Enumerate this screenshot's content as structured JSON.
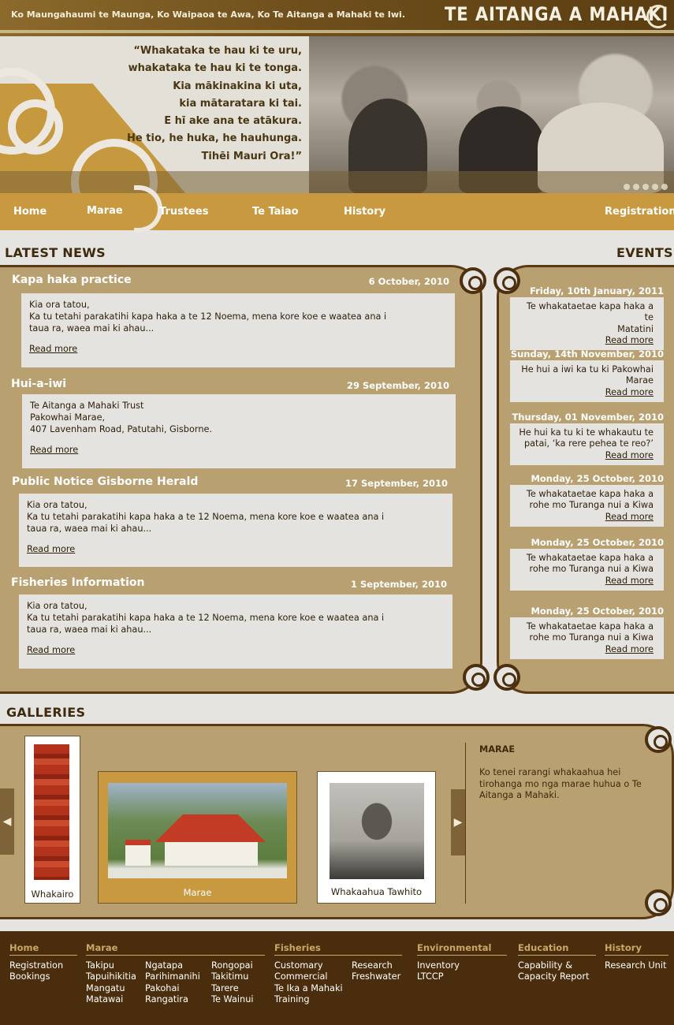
{
  "header": {
    "tagline": "Ko Maungahaumi te Maunga, Ko Waipaoa te Awa, Ko Te Aitanga a Mahaki te Iwi.",
    "logo": "TE AITANGA A MAHAKI"
  },
  "hero": {
    "poem": [
      "“Whakataka te hau ki te uru,",
      "whakataka te hau ki te tonga.",
      "Kia mākinakina ki uta,",
      "kia mātaratara ki tai.",
      "E hī ake ana te atākura.",
      "He tio, he huka, he hauhunga.",
      "Tihēi Mauri Ora!”"
    ]
  },
  "nav": {
    "items": [
      {
        "label": "Home"
      },
      {
        "label": "Marae"
      },
      {
        "label": "Trustees"
      },
      {
        "label": "Te Taiao"
      },
      {
        "label": "History"
      },
      {
        "label": "Registration"
      }
    ]
  },
  "news": {
    "heading": "LATEST NEWS",
    "items": [
      {
        "title": "Kapa haka practice",
        "date": "6 October, 2010",
        "body": "Kia ora tatou,\nKa tu tetahi parakatihi kapa haka a te 12 Noema, mena kore koe e waatea ana i\ntaua ra, waea mai ki ahau...",
        "more": "Read more"
      },
      {
        "title": "Hui-a-iwi",
        "date": "29 September, 2010",
        "body": "Te Aitanga a Mahaki Trust\nPakowhai Marae,\n407 Lavenham Road, Patutahi, Gisborne.",
        "more": "Read more"
      },
      {
        "title": "Public Notice Gisborne Herald",
        "date": "17 September, 2010",
        "body": "Kia ora tatou,\nKa tu tetahi parakatihi kapa haka a te 12 Noema, mena kore koe e waatea ana i\ntaua ra, waea mai ki ahau...",
        "more": "Read more"
      },
      {
        "title": "Fisheries Information",
        "date": "1 September, 2010",
        "body": "Kia ora tatou,\nKa tu tetahi parakatihi kapa haka a te 12 Noema, mena kore koe e waatea ana i\ntaua ra, waea mai ki ahau...",
        "more": "Read more"
      }
    ]
  },
  "events": {
    "heading": "EVENTS",
    "items": [
      {
        "date": "Friday, 10th January, 2011",
        "lines": [
          "Te whakataetae kapa haka a te",
          "Matatini"
        ],
        "more": "Read more"
      },
      {
        "date": "Sunday, 14th November, 2010",
        "lines": [
          "He hui a iwi ka tu ki Pakowhai",
          "Marae"
        ],
        "more": "Read more"
      },
      {
        "date": "Thursday, 01 November, 2010",
        "lines": [
          "He hui ka tu ki te whakautu te",
          "patai, ‘ka rere pehea te reo?’"
        ],
        "more": "Read more"
      },
      {
        "date": "Monday, 25 October, 2010",
        "lines": [
          "Te whakataetae kapa haka a",
          "rohe mo Turanga nui a Kiwa"
        ],
        "more": "Read more"
      },
      {
        "date": "Monday, 25 October, 2010",
        "lines": [
          "Te whakataetae kapa haka a",
          "rohe mo Turanga nui a Kiwa"
        ],
        "more": "Read more"
      },
      {
        "date": "Monday, 25 October, 2010",
        "lines": [
          "Te whakataetae kapa haka a",
          "rohe mo Turanga nui a Kiwa"
        ],
        "more": "Read more"
      }
    ]
  },
  "galleries": {
    "heading": "GALLERIES",
    "prev_icon": "arrow-left-icon",
    "next_icon": "arrow-right-icon",
    "cards": [
      {
        "caption": "Whakairo"
      },
      {
        "caption": "Marae"
      },
      {
        "caption": "Whakaahua Tawhito"
      }
    ],
    "detail_title": "MARAE",
    "detail_text": [
      "Ko tenei rarangi whakaahua hei",
      "tirohanga mo nga marae huhua o Te",
      "Aitanga a Mahaki."
    ]
  },
  "footer": {
    "home": {
      "head": "Home",
      "links": [
        "Registration",
        "Bookings"
      ]
    },
    "marae": {
      "head": "Marae",
      "col1": [
        "Takipu",
        "Tapuihikitia",
        "Mangatu",
        "Matawai"
      ],
      "col2": [
        "Ngatapa",
        "Parihimanihi",
        "Pakohai",
        "Rangatira"
      ],
      "col3": [
        "Rongopai",
        "Takitimu",
        "Tarere",
        "Te Wainui"
      ]
    },
    "fisheries": {
      "head": "Fisheries",
      "col1": [
        "Customary",
        "Commercial",
        "Te Ika a Mahaki",
        "Training"
      ],
      "col2": [
        "Research",
        "Freshwater"
      ]
    },
    "environmental": {
      "head": "Environmental",
      "links": [
        "Inventory",
        "LTCCP"
      ]
    },
    "education": {
      "head": "Education",
      "links": [
        "Capability &",
        "Capacity Report"
      ]
    },
    "history": {
      "head": "History",
      "links": [
        "Research Unit"
      ]
    }
  }
}
